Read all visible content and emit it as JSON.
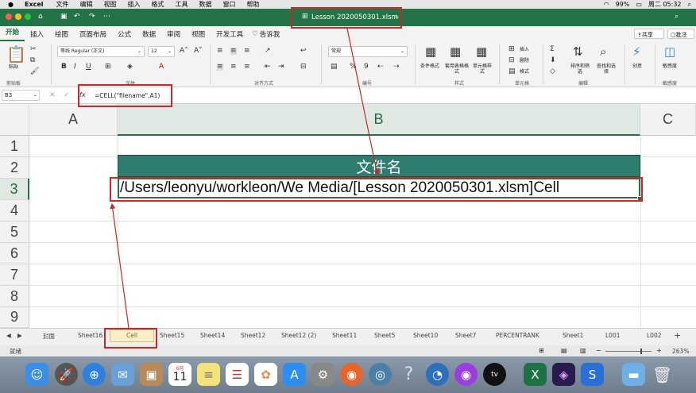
{
  "menubar": {
    "app": "Excel",
    "items": [
      "文件",
      "编辑",
      "视图",
      "插入",
      "格式",
      "工具",
      "数据",
      "窗口",
      "帮助"
    ],
    "battery": "99%",
    "clock": "周二 05:32"
  },
  "title": {
    "filename": "Lesson 2020050301.xlsm"
  },
  "ribbon_tabs": [
    "开始",
    "插入",
    "绘图",
    "页面布局",
    "公式",
    "数据",
    "审阅",
    "视图",
    "开发工具"
  ],
  "tell_me": "告诉我",
  "share": "共享",
  "comment": "批注",
  "ribbon": {
    "paste": "粘贴",
    "clipboard_label": "剪贴板",
    "font_name": "等线 Regular (正文)",
    "font_size": "12",
    "font_label": "字体",
    "align_label": "对齐方式",
    "number_format": "常规",
    "number_label": "编号",
    "cond_format": "条件格式",
    "table_format": "套用表格格式",
    "cell_style": "单元格样式",
    "style_label": "样式",
    "insert": "插入",
    "delete": "删除",
    "format": "格式",
    "cells_label": "单元格",
    "sort_filter": "排序和筛选",
    "find_select": "查找和选择",
    "edit_label": "编辑",
    "creative": "创意",
    "sensitivity": "敏感度",
    "sensitivity_label": "敏感度"
  },
  "formula_bar": {
    "name_box": "B3",
    "fx": "fx",
    "formula": "=CELL(\"filename\",A1)"
  },
  "columns": [
    "A",
    "B",
    "C"
  ],
  "rows": [
    "1",
    "2",
    "3",
    "4",
    "5",
    "6",
    "7",
    "8",
    "9"
  ],
  "cells": {
    "b2": "文件名",
    "b3": "/Users/leonyu/workleon/We Media/[Lesson 2020050301.xlsm]Cell"
  },
  "colors": {
    "excel_green": "#227446",
    "header_fill": "#2e7d6e",
    "annotation": "#c8282c"
  },
  "sheet_tabs": [
    "封面",
    "Sheet16",
    "Cell",
    "Sheet15",
    "Sheet14",
    "Sheet12",
    "Sheet12 (2)",
    "Sheet11",
    "Sheet5",
    "Sheet10",
    "Sheet7",
    "PERCENTRANK",
    "Sheet1",
    "L001",
    "L002"
  ],
  "active_sheet": "Cell",
  "status": {
    "mode": "就绪",
    "zoom": "263%"
  },
  "dock": [
    "finder-icon",
    "launchpad-icon",
    "safari-icon",
    "mail-icon",
    "contacts-icon",
    "calendar-icon",
    "notes-icon",
    "reminders-icon",
    "photos-icon",
    "appstore-icon",
    "system-preferences-icon",
    "firefox-icon",
    "mysql-icon",
    "help-icon",
    "activity-icon",
    "podcasts-icon",
    "appletv-icon",
    "excel-icon",
    "premiere-icon",
    "snagit-icon",
    "folder-icon",
    "trash-icon"
  ],
  "calendar": {
    "month": "6月",
    "day": "11"
  },
  "appletv_label": "tv"
}
